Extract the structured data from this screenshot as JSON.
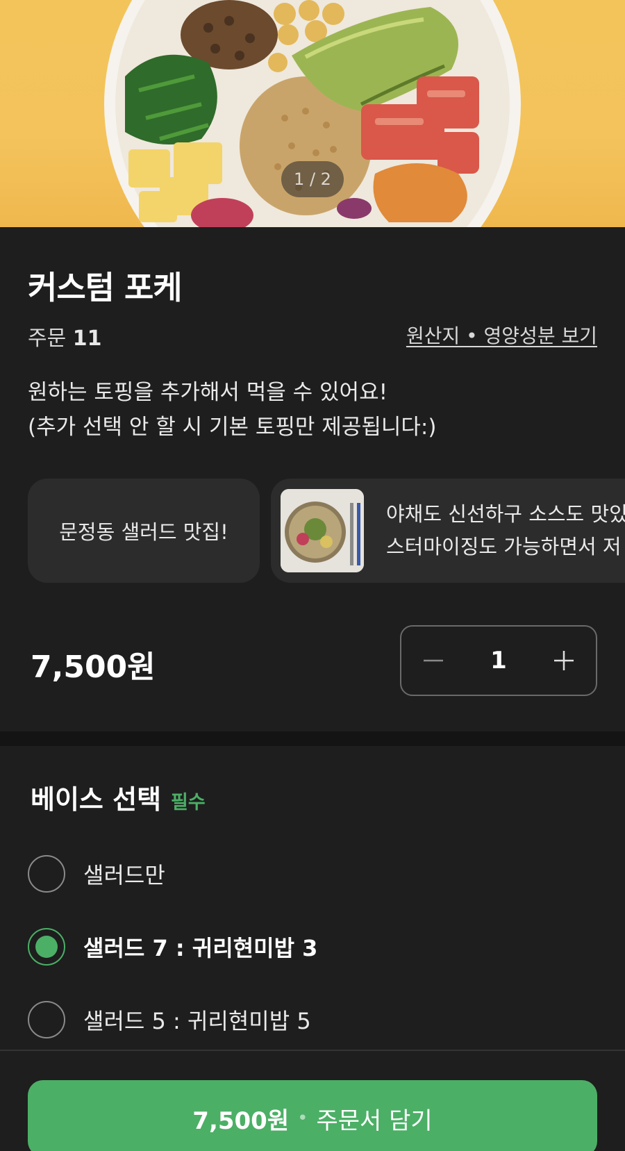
{
  "hero": {
    "pager": "1 / 2",
    "image": "poke-bowl-photo"
  },
  "product": {
    "title": "커스텀 포케",
    "orders_label": "주문",
    "orders_count": "11",
    "origin_link": "원산지 • 영양성분 보기",
    "description_line1": "원하는 토핑을 추가해서 먹을 수 있어요!",
    "description_line2": "(추가 선택 안 할 시 기본 토핑만 제공됩니다:)"
  },
  "reviews": {
    "tag_card": "문정동 샐러드 맛집!",
    "photo_card_line1": "야채도 신선하구 소스도 맛있",
    "photo_card_line2": "스터마이징도 가능하면서 저"
  },
  "price": "7,500원",
  "quantity": {
    "value": "1",
    "minus_icon": "minus-icon",
    "plus_icon": "plus-icon"
  },
  "base_section": {
    "title": "베이스 선택",
    "required_badge": "필수",
    "options": [
      {
        "label": "샐러드만",
        "selected": false
      },
      {
        "label": "샐러드 7 : 귀리현미밥 3",
        "selected": true
      },
      {
        "label": "샐러드 5 : 귀리현미밥 5",
        "selected": false
      }
    ]
  },
  "cta": {
    "price": "7,500원",
    "separator": "•",
    "label": "주문서 담기"
  },
  "colors": {
    "accent": "#4caf66",
    "background": "#1e1e1e",
    "card": "#2c2c2c"
  }
}
